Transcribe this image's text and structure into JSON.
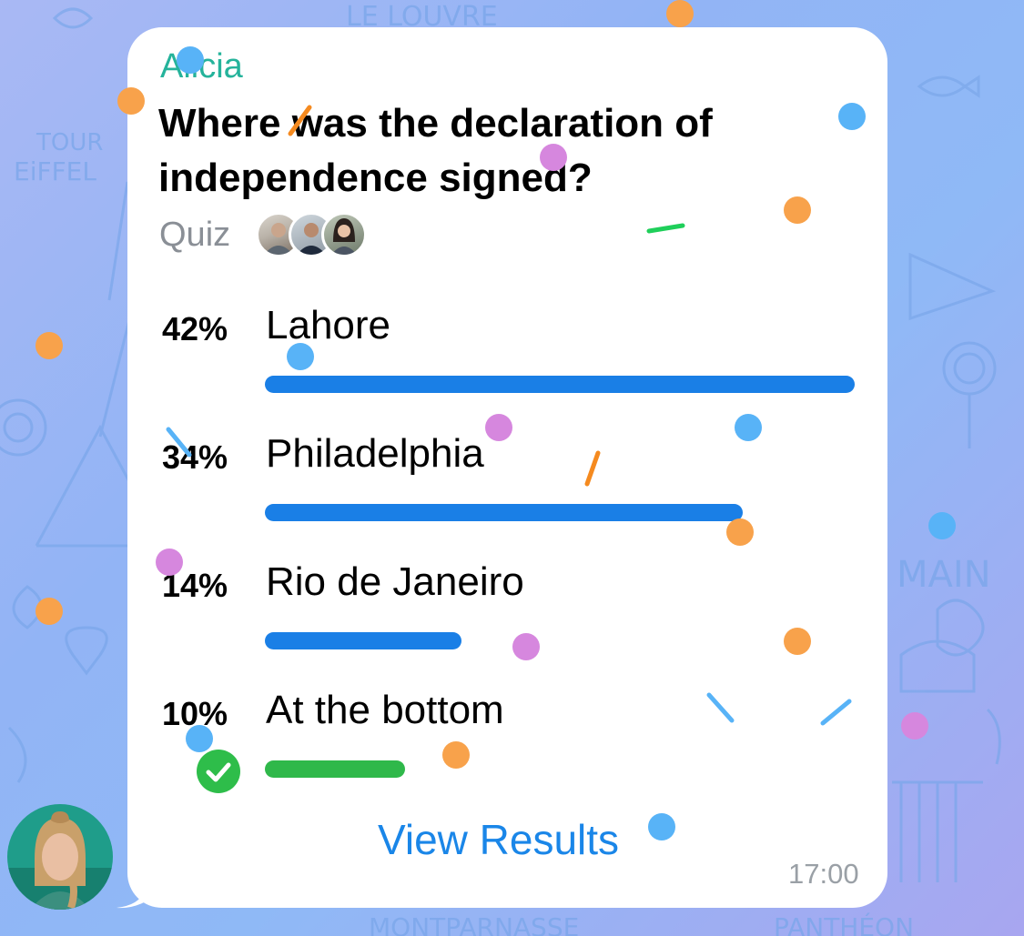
{
  "message": {
    "sender": "Alicia",
    "question": "Where was the declaration of independence signed?",
    "poll_type": "Quiz",
    "voters": [
      "voter-1",
      "voter-2",
      "voter-3"
    ],
    "time": "17:00",
    "view_results_label": "View Results"
  },
  "poll": {
    "options": [
      {
        "percent": "42%",
        "label": "Lahore",
        "value": 42,
        "color": "#1a7fe6",
        "correct": false
      },
      {
        "percent": "34%",
        "label": "Philadelphia",
        "value": 34,
        "color": "#1a7fe6",
        "correct": false
      },
      {
        "percent": "14%",
        "label": "Rio de Janeiro",
        "value": 14,
        "color": "#1a7fe6",
        "correct": false
      },
      {
        "percent": "10%",
        "label": "At the bottom",
        "value": 10,
        "color": "#2fb84a",
        "correct": true
      }
    ]
  },
  "colors": {
    "accent": "#1a86e8",
    "sender": "#25b39b",
    "correct": "#2ebd4a"
  },
  "icons": {
    "correct_answer": "checkmark-icon"
  }
}
